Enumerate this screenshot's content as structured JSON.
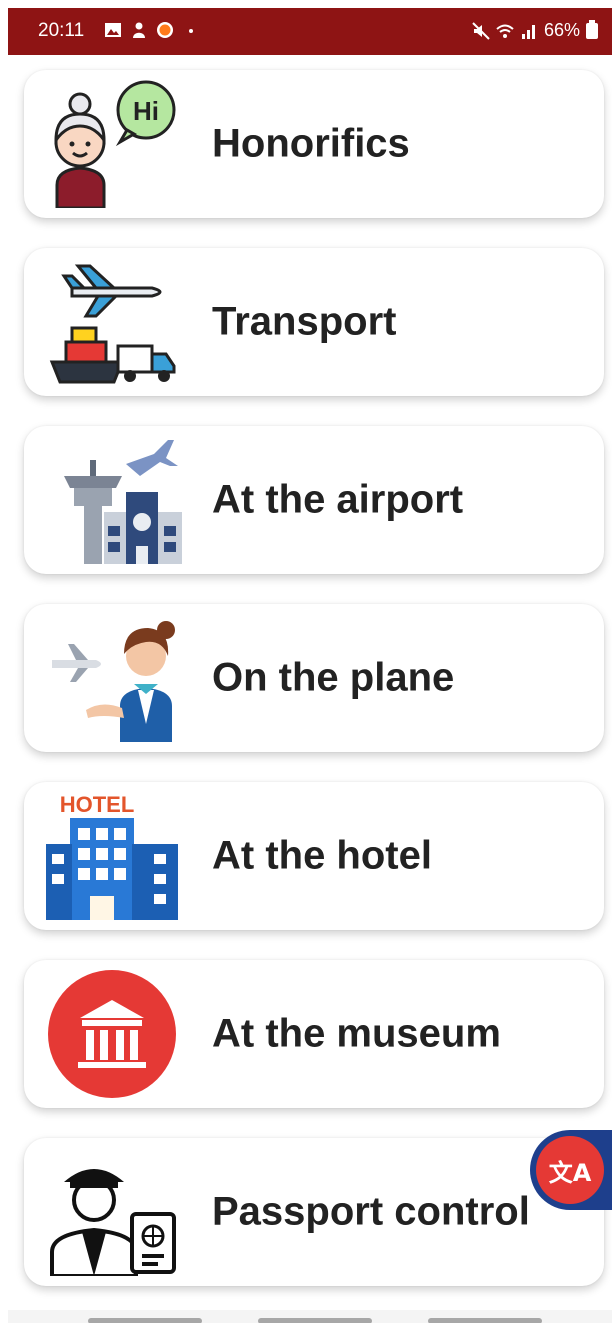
{
  "status_bar": {
    "time": "20:11",
    "battery": "66%",
    "left_icons": [
      "gallery-icon",
      "person-icon",
      "app-notification-icon",
      "dot-icon"
    ],
    "right_icons": [
      "mute-icon",
      "wifi-icon",
      "signal-icon",
      "battery-icon"
    ]
  },
  "categories": [
    {
      "label": "Honorifics",
      "icon": "honorifics-icon",
      "speech": "Hi"
    },
    {
      "label": "Transport",
      "icon": "transport-icon"
    },
    {
      "label": "At the airport",
      "icon": "airport-icon"
    },
    {
      "label": "On the plane",
      "icon": "stewardess-icon"
    },
    {
      "label": "At the hotel",
      "icon": "hotel-icon",
      "sign": "HOTEL"
    },
    {
      "label": "At the museum",
      "icon": "museum-icon"
    },
    {
      "label": "Passport control",
      "icon": "passport-officer-icon"
    }
  ],
  "fab": {
    "icon": "translate-icon",
    "glyph": "文A"
  },
  "colors": {
    "status_bar": "#8e1414",
    "fab_outer": "#1e3f8c",
    "fab_inner": "#e53935"
  }
}
